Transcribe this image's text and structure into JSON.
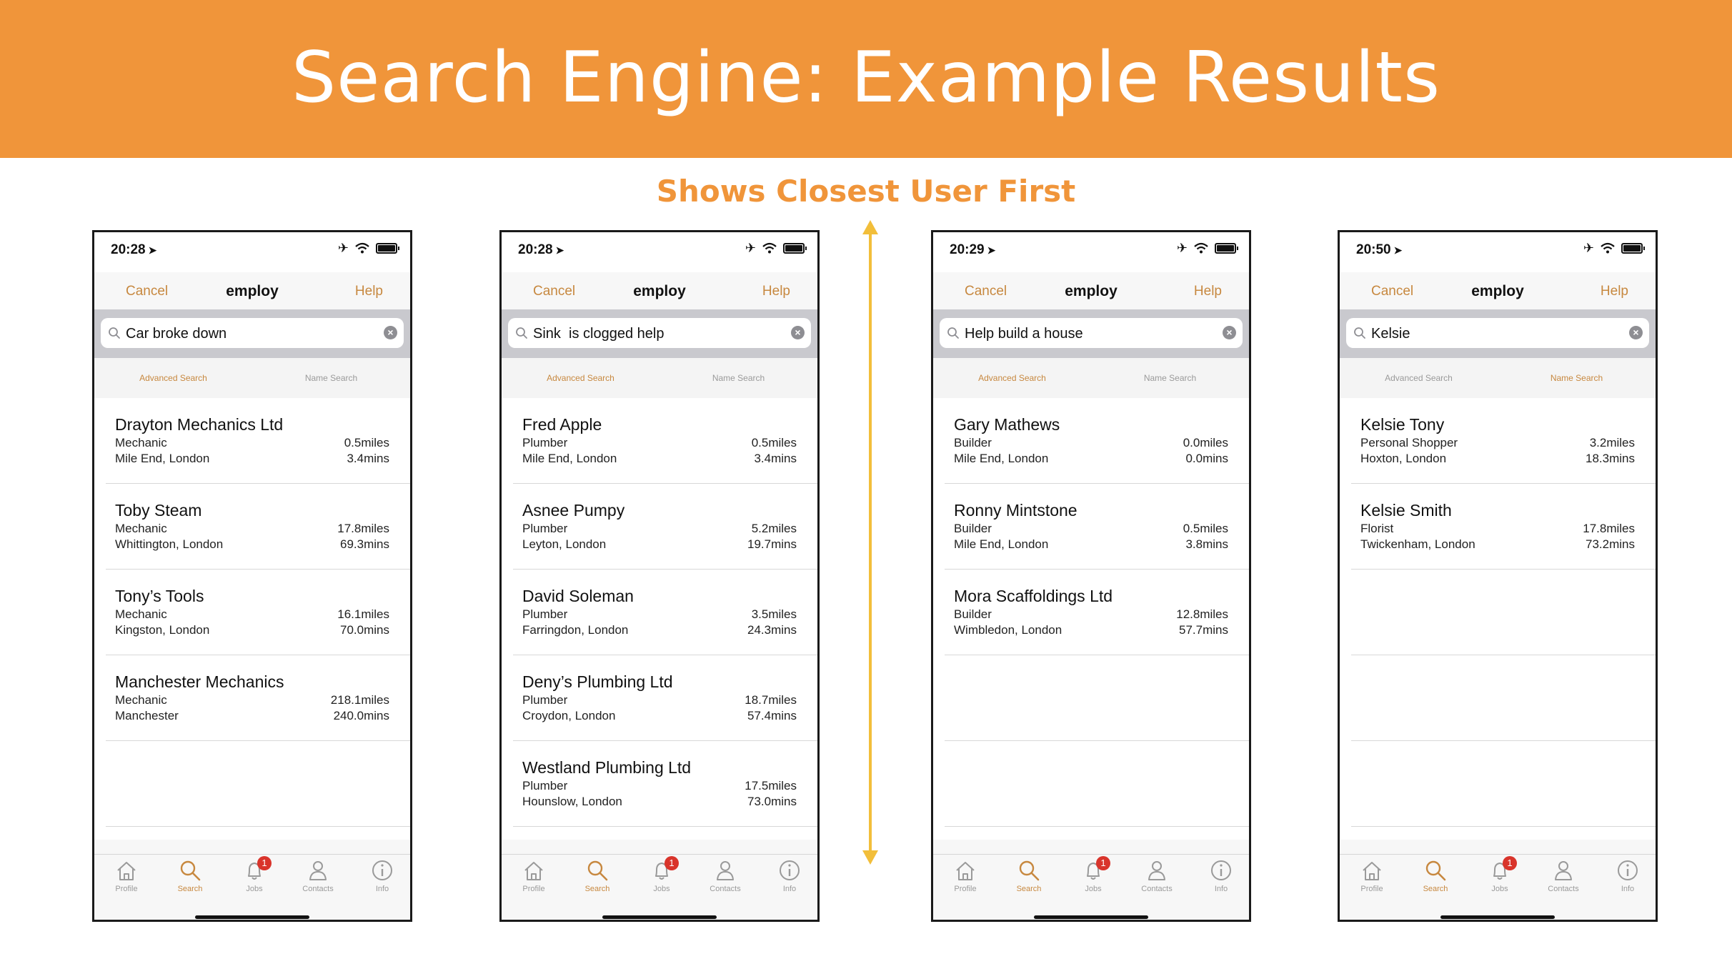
{
  "banner": {
    "title": "Search Engine: Example Results"
  },
  "subtitle": "Shows Closest User First",
  "colors": {
    "banner": "#F0953A",
    "accent": "#C7883F",
    "arrow": "#F2BE3A",
    "badge": "#D9342B"
  },
  "common": {
    "nav": {
      "cancel": "Cancel",
      "title": "employ",
      "help": "Help"
    },
    "segments": {
      "advanced": "Advanced Search",
      "name": "Name Search"
    },
    "tabs": [
      {
        "label": "Profile",
        "icon": "home-icon"
      },
      {
        "label": "Search",
        "icon": "search-icon"
      },
      {
        "label": "Jobs",
        "icon": "bell-icon",
        "badge": "1"
      },
      {
        "label": "Contacts",
        "icon": "person-icon"
      },
      {
        "label": "Info",
        "icon": "info-icon"
      }
    ]
  },
  "phones": [
    {
      "time": "20:28",
      "query": "Car broke down",
      "active_segment": "advanced",
      "results": [
        {
          "name": "Drayton Mechanics Ltd",
          "trade": "Mechanic",
          "place": "Mile End, London",
          "miles": "0.5miles",
          "mins": "3.4mins"
        },
        {
          "name": "Toby Steam",
          "trade": "Mechanic",
          "place": "Whittington, London",
          "miles": "17.8miles",
          "mins": "69.3mins"
        },
        {
          "name": "Tony’s Tools",
          "trade": "Mechanic",
          "place": "Kingston, London",
          "miles": "16.1miles",
          "mins": "70.0mins"
        },
        {
          "name": "Manchester Mechanics",
          "trade": "Mechanic",
          "place": "Manchester",
          "miles": "218.1miles",
          "mins": "240.0mins"
        }
      ]
    },
    {
      "time": "20:28",
      "query": "Sink  is clogged help",
      "active_segment": "advanced",
      "results": [
        {
          "name": "Fred Apple",
          "trade": "Plumber",
          "place": "Mile End, London",
          "miles": "0.5miles",
          "mins": "3.4mins"
        },
        {
          "name": "Asnee Pumpy",
          "trade": "Plumber",
          "place": "Leyton, London",
          "miles": "5.2miles",
          "mins": "19.7mins"
        },
        {
          "name": "David Soleman",
          "trade": "Plumber",
          "place": "Farringdon, London",
          "miles": "3.5miles",
          "mins": "24.3mins"
        },
        {
          "name": "Deny’s Plumbing Ltd",
          "trade": "Plumber",
          "place": "Croydon, London",
          "miles": "18.7miles",
          "mins": "57.4mins"
        },
        {
          "name": "Westland Plumbing Ltd",
          "trade": "Plumber",
          "place": "Hounslow, London",
          "miles": "17.5miles",
          "mins": "73.0mins"
        }
      ]
    },
    {
      "time": "20:29",
      "query": "Help build a house",
      "active_segment": "advanced",
      "results": [
        {
          "name": "Gary Mathews",
          "trade": "Builder",
          "place": "Mile End, London",
          "miles": "0.0miles",
          "mins": "0.0mins"
        },
        {
          "name": "Ronny Mintstone",
          "trade": "Builder",
          "place": "Mile End, London",
          "miles": "0.5miles",
          "mins": "3.8mins"
        },
        {
          "name": "Mora Scaffoldings Ltd",
          "trade": "Builder",
          "place": "Wimbledon, London",
          "miles": "12.8miles",
          "mins": "57.7mins"
        }
      ]
    },
    {
      "time": "20:50",
      "query": "Kelsie",
      "active_segment": "name",
      "results": [
        {
          "name": "Kelsie Tony",
          "trade": "Personal Shopper",
          "place": "Hoxton, London",
          "miles": "3.2miles",
          "mins": "18.3mins"
        },
        {
          "name": "Kelsie Smith",
          "trade": "Florist",
          "place": "Twickenham, London",
          "miles": "17.8miles",
          "mins": "73.2mins"
        }
      ]
    }
  ]
}
